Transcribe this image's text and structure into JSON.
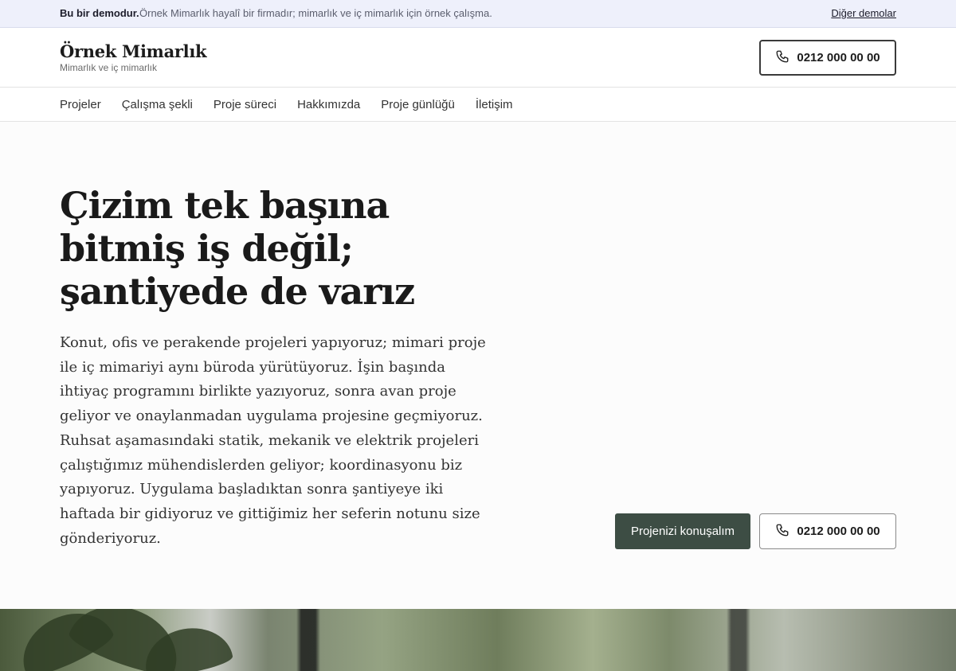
{
  "demo_bar": {
    "strong": "Bu bir demodur.",
    "note": "Örnek Mimarlık hayalî bir firmadır; mimarlık ve iç mimarlık için örnek çalışma.",
    "other_link": "Diğer demolar"
  },
  "header": {
    "brand_name": "Örnek Mimarlık",
    "brand_tagline": "Mimarlık ve iç mimarlık",
    "phone": "0212 000 00 00"
  },
  "nav": {
    "items": [
      "Projeler",
      "Çalışma şekli",
      "Proje süreci",
      "Hakkımızda",
      "Proje günlüğü",
      "İletişim"
    ]
  },
  "hero": {
    "title": "Çizim tek başına bitmiş iş değil; şantiyede de varız",
    "lead": "Konut, ofis ve perakende projeleri yapıyoruz; mimari proje ile iç mimariyi aynı büroda yürütüyoruz. İşin başında ihtiyaç programını birlikte yazıyoruz, sonra avan proje geliyor ve onaylanmadan uygulama projesine geçmiyoruz. Ruhsat aşamasındaki statik, mekanik ve elektrik projeleri çalıştığımız mühendislerden geliyor; koordinasyonu biz yapıyoruz. Uygulama başladıktan sonra şantiyeye iki haftada bir gidiyoruz ve gittiğimiz her seferin notunu size gönderiyoruz.",
    "cta_label": "Projenizi konuşalım",
    "phone": "0212 000 00 00"
  },
  "colors": {
    "accent": "#3d4d44",
    "demo_bar_bg": "#eef0fb"
  },
  "icons": {
    "phone": "phone-icon"
  }
}
